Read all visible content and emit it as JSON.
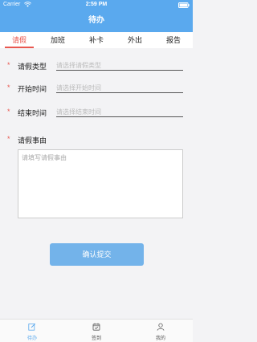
{
  "status": {
    "carrier": "Carrier",
    "time": "2:59 PM"
  },
  "header": {
    "title": "待办"
  },
  "tabs": [
    {
      "label": "请假"
    },
    {
      "label": "加班"
    },
    {
      "label": "补卡"
    },
    {
      "label": "外出"
    },
    {
      "label": "报告"
    }
  ],
  "form": {
    "leave_type": {
      "label": "请假类型",
      "placeholder": "请选择请假类型"
    },
    "start_time": {
      "label": "开始时间",
      "placeholder": "请选择开始时间"
    },
    "end_time": {
      "label": "结束时间",
      "placeholder": "请选择结束时间"
    },
    "reason": {
      "label": "请假事由",
      "placeholder": "请填写请假事由"
    },
    "required_mark": "*"
  },
  "submit_label": "确认提交",
  "tabbar": [
    {
      "label": "待办",
      "icon": "edit-icon"
    },
    {
      "label": "签到",
      "icon": "calendar-check-icon"
    },
    {
      "label": "我的",
      "icon": "user-icon"
    }
  ],
  "colors": {
    "accent": "#5aa9ee",
    "active_tab": "#e9574f",
    "button": "#73b3ea"
  }
}
